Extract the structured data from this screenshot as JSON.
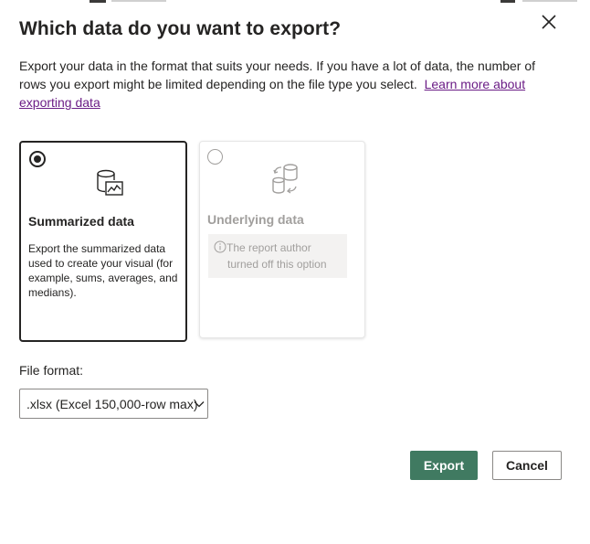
{
  "dialog": {
    "title": "Which data do you want to export?",
    "description": "Export your data in the format that suits your needs. If you have a lot of data, the number of rows you export might be limited depending on the file type you select.",
    "learn_more_link": "Learn more about exporting data",
    "close_icon": "close-icon"
  },
  "options": {
    "summarized": {
      "title": "Summarized data",
      "description": "Export the summarized data used to create your visual (for example, sums, averages, and medians).",
      "selected": true,
      "icon": "database-chart-icon"
    },
    "underlying": {
      "title": "Underlying data",
      "notice_line1": "The report author",
      "notice_line2": "turned off this option",
      "disabled": true,
      "icon": "database-sync-icon"
    }
  },
  "file_format": {
    "label": "File format:",
    "selected_value": ".xlsx (Excel 150,000-row max)"
  },
  "buttons": {
    "export": "Export",
    "cancel": "Cancel"
  },
  "colors": {
    "primary_button": "#407a61",
    "link": "#6b1d86",
    "disabled_text": "#a19f9d"
  }
}
